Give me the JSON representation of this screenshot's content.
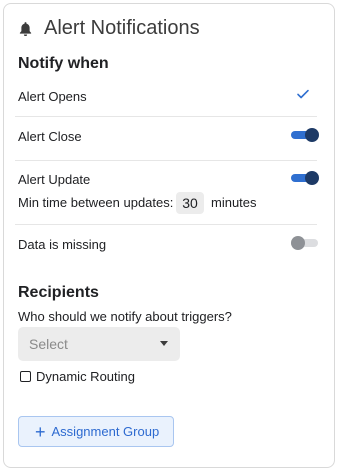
{
  "header": {
    "title": "Alert Notifications",
    "icon": "bell-icon"
  },
  "notify": {
    "heading": "Notify when",
    "alert_opens": {
      "label": "Alert Opens",
      "checked": true
    },
    "alert_close": {
      "label": "Alert Close",
      "enabled": true
    },
    "alert_update": {
      "label": "Alert Update",
      "enabled": true,
      "min_time_label": "Min time between updates:",
      "min_time_value": "30",
      "min_time_unit": "minutes"
    },
    "data_missing": {
      "label": "Data is missing",
      "enabled": false
    }
  },
  "recipients": {
    "heading": "Recipients",
    "question": "Who should we notify about triggers?",
    "select_placeholder": "Select",
    "dynamic_routing_label": "Dynamic Routing",
    "dynamic_routing_checked": false,
    "add_group_label": "Assignment Group"
  },
  "colors": {
    "accent": "#2f6fd0",
    "toggle_knob_on": "#1d3a66",
    "button_bg": "#eaf2fd"
  }
}
